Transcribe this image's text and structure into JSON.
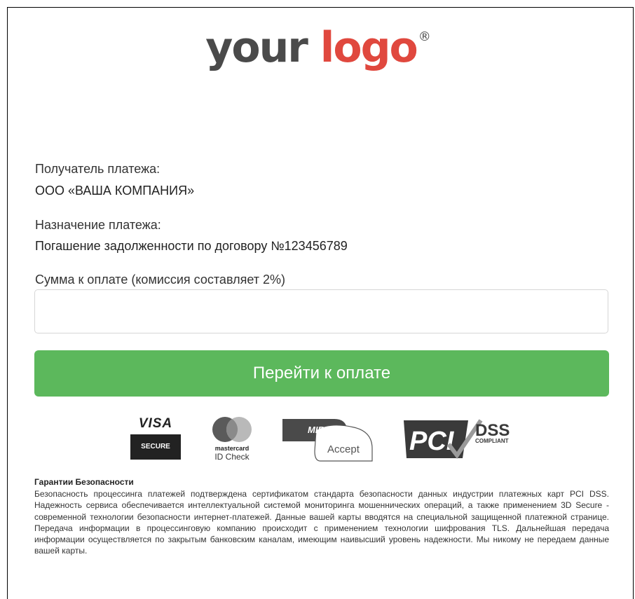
{
  "logo": {
    "word1": "your",
    "word2": "logo",
    "mark": "®"
  },
  "recipient": {
    "label": "Получатель платежа:",
    "value": "ООО «ВАША КОМПАНИЯ»"
  },
  "purpose": {
    "label": "Назначение платежа:",
    "value": "Погашение задолженности по договору №123456789"
  },
  "amount": {
    "label": "Сумма к оплате (комиссия составляет 2%)",
    "value": "",
    "placeholder": ""
  },
  "pay_button": {
    "label": "Перейти к оплате"
  },
  "badges": {
    "visa": {
      "brand": "VISA",
      "sub": "SECURE",
      "icon": "visa-secure-icon"
    },
    "mastercard": {
      "brand": "mastercard",
      "sub": "ID Check",
      "icon": "mastercard-id-check-icon"
    },
    "mir": {
      "brand": "MIR",
      "sub": "Accept",
      "icon": "mir-accept-icon"
    },
    "pci": {
      "brand": "PCI",
      "sub1": "DSS",
      "sub2": "COMPLIANT",
      "icon": "pci-dss-icon"
    }
  },
  "security": {
    "title": "Гарантии Безопасности",
    "text": "Безопасность процессинга платежей подтверждена сертификатом стандарта безопасности данных индустрии платежных карт PCI DSS. Надежность сервиса обеспечивается интеллектуальной системой мониторинга мошеннических операций, а также применением 3D Secure - современной технологии безопасности интернет-платежей. Данные вашей карты вводятся на специальной защищенной платежной странице. Передача информации в процессинговую компанию происходит с применением технологии шифрования TLS. Дальнейшая передача информации осуществляется по закрытым банковским каналам, имеющим наивысший уровень надежности. Мы никому не передаем данные вашей карты."
  },
  "colors": {
    "accent": "#5cb85c",
    "logo_red": "#e0483e",
    "logo_gray": "#4a4a4a"
  }
}
